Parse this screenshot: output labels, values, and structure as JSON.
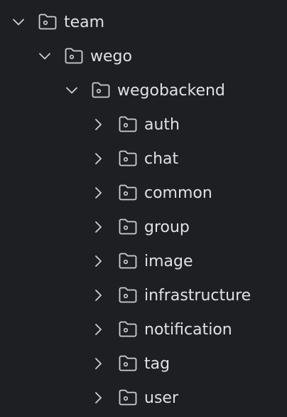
{
  "tree": {
    "root": {
      "label": "team",
      "icon": "folder-icon",
      "expanded": true
    },
    "level1": {
      "label": "wego",
      "icon": "folder-icon",
      "expanded": true
    },
    "level2": {
      "label": "wegobackend",
      "icon": "folder-icon",
      "expanded": true
    },
    "children": [
      {
        "label": "auth",
        "icon": "folder-icon",
        "expanded": false
      },
      {
        "label": "chat",
        "icon": "folder-icon",
        "expanded": false
      },
      {
        "label": "common",
        "icon": "folder-icon",
        "expanded": false
      },
      {
        "label": "group",
        "icon": "folder-icon",
        "expanded": false
      },
      {
        "label": "image",
        "icon": "folder-icon",
        "expanded": false
      },
      {
        "label": "infrastructure",
        "icon": "folder-icon",
        "expanded": false
      },
      {
        "label": "notification",
        "icon": "folder-icon",
        "expanded": false
      },
      {
        "label": "tag",
        "icon": "folder-icon",
        "expanded": false
      },
      {
        "label": "user",
        "icon": "folder-icon",
        "expanded": false
      }
    ]
  },
  "colors": {
    "background": "#1e1f22",
    "text": "#dfe1e5",
    "icon": "#ced0d6"
  }
}
